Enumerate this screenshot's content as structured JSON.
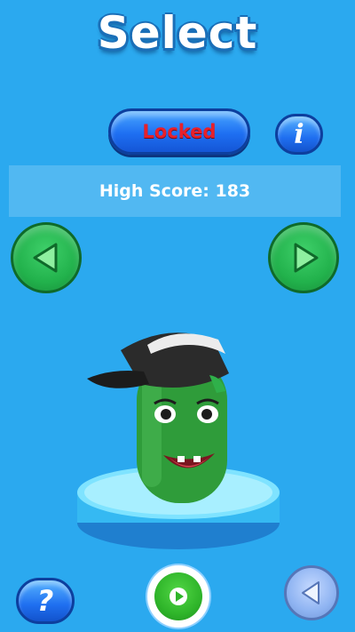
{
  "screen": {
    "title": "Select"
  },
  "status": {
    "locked_label": "Locked"
  },
  "info": {
    "icon": "info-icon",
    "glyph": "i"
  },
  "score": {
    "text": "High Score: 183"
  },
  "nav": {
    "prev_icon": "arrow-left-icon",
    "next_icon": "arrow-right-icon"
  },
  "footer": {
    "help_glyph": "?",
    "help_icon": "question-icon",
    "play_icon": "play-icon",
    "back_icon": "back-triangle-icon"
  },
  "colors": {
    "background": "#2ba9ef",
    "locked_text": "#e8202a",
    "button_blue": "#1e6ff2",
    "arrow_green": "#22b24c",
    "character_green": "#2f9c3a",
    "cap": "#2b2b2b"
  }
}
